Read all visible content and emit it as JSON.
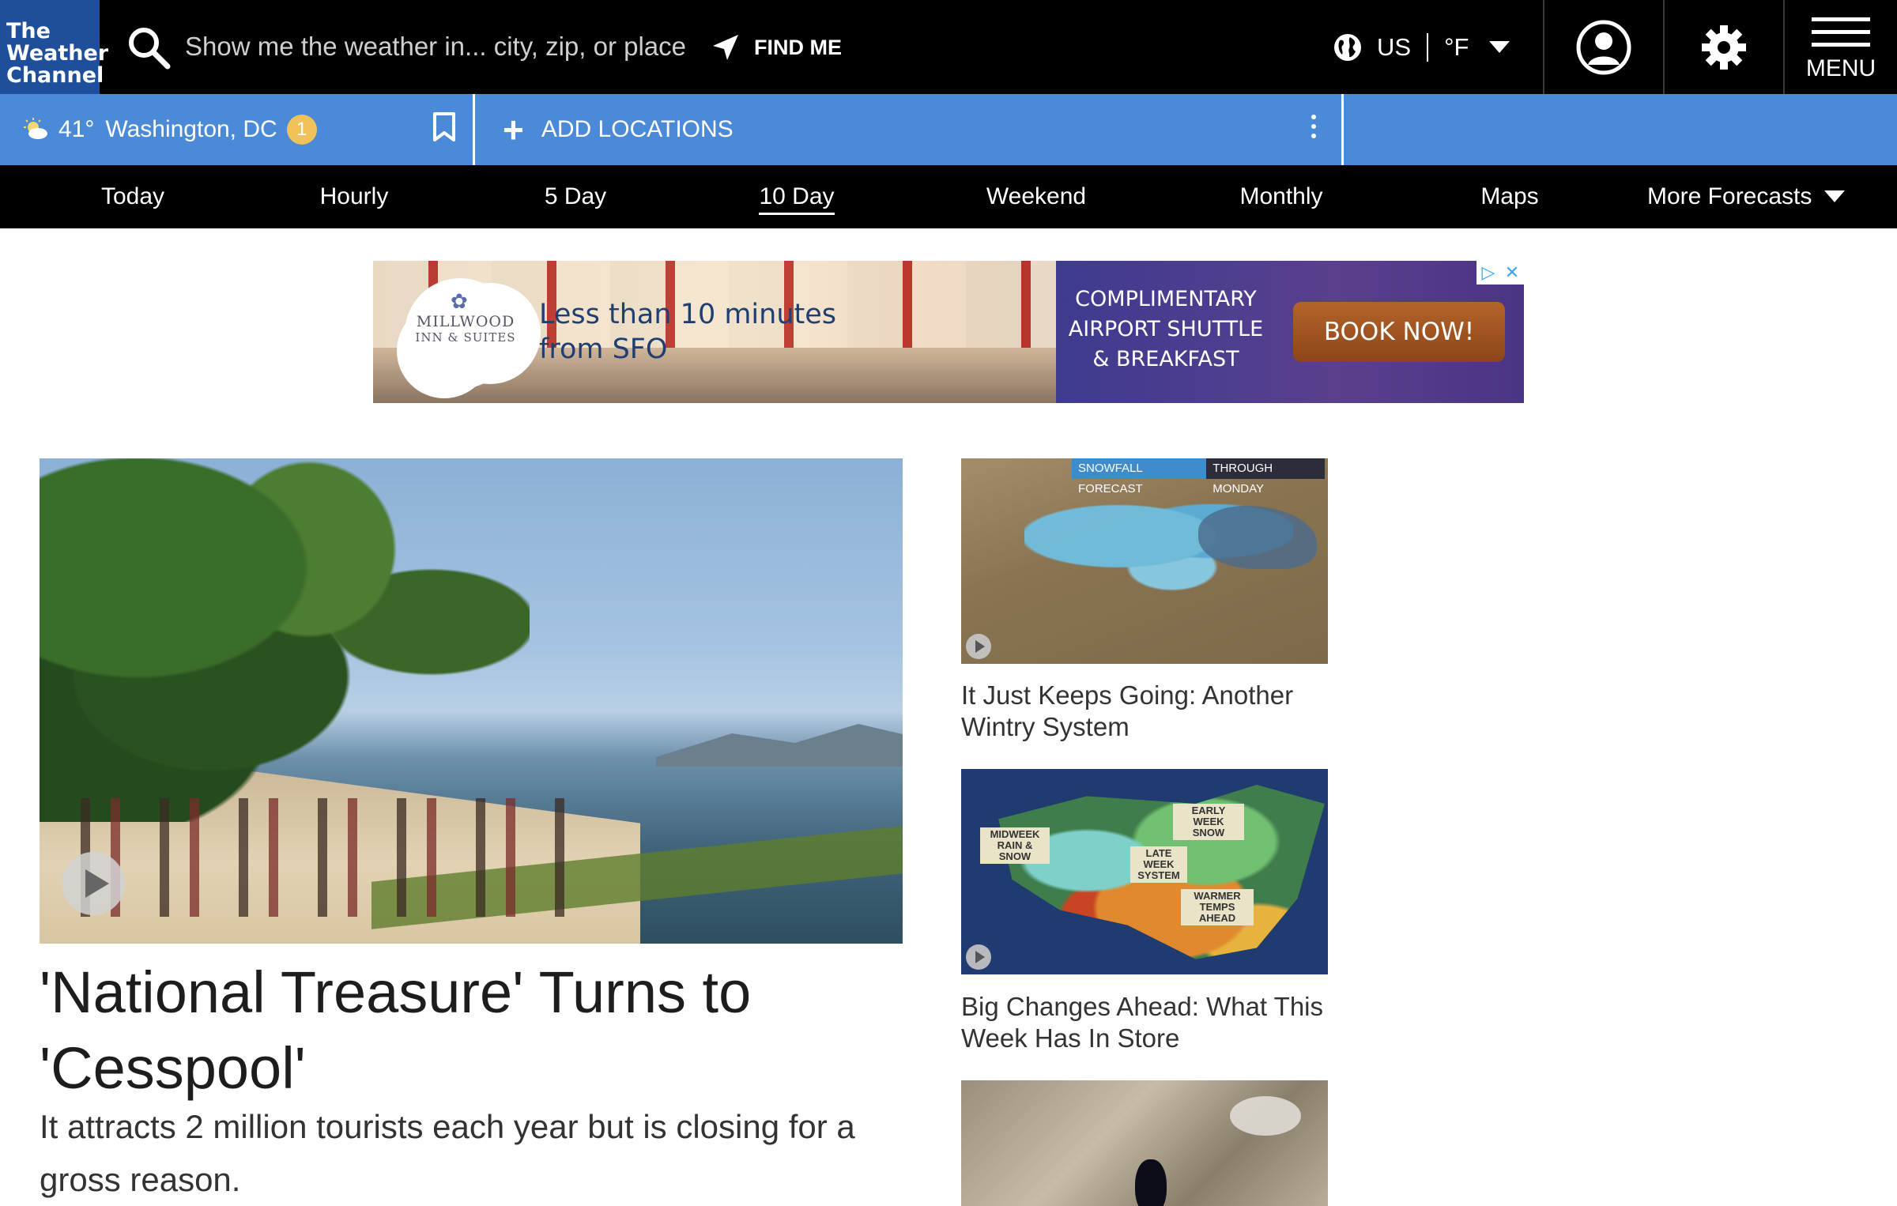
{
  "header": {
    "logo_lines": [
      "The",
      "Weather",
      "Channel"
    ],
    "search_placeholder": "Show me the weather in... city, zip, or place",
    "find_me_label": "FIND ME",
    "region": "US",
    "unit": "°F",
    "menu_label": "MENU"
  },
  "location_bar": {
    "temperature": "41°",
    "city": "Washington, DC",
    "alert_count": "1",
    "add_locations_label": "ADD LOCATIONS"
  },
  "nav": {
    "items": [
      "Today",
      "Hourly",
      "5 Day",
      "10 Day",
      "Weekend",
      "Monthly",
      "Maps",
      "More Forecasts"
    ],
    "active": "10 Day"
  },
  "ad": {
    "brand_line1": "MILLWOOD",
    "brand_line2": "INN & SUITES",
    "headline": "Less than 10 minutes from SFO",
    "offer": "COMPLIMENTARY AIRPORT SHUTTLE & BREAKFAST",
    "cta": "BOOK NOW!"
  },
  "lead_story": {
    "title": "'National Treasure' Turns to 'Cesspool'",
    "description": "It attracts 2 million tourists each year but is closing for a gross reason."
  },
  "side_stories": [
    {
      "title": "It Just Keeps Going: Another Wintry System",
      "legend_left": "SNOWFALL FORECAST",
      "legend_right": "THROUGH MONDAY"
    },
    {
      "title": "Big Changes Ahead: What This Week Has In Store",
      "map_labels": [
        "EARLY WEEK SNOW",
        "MIDWEEK RAIN & SNOW",
        "LATE WEEK SYSTEM",
        "WARMER TEMPS AHEAD"
      ]
    },
    {
      "title": ""
    }
  ],
  "colors": {
    "header_bg": "#000000",
    "logo_bg": "#1f4f9b",
    "location_bar_bg": "#4a8ad6",
    "alert_badge": "#f0c35a"
  }
}
